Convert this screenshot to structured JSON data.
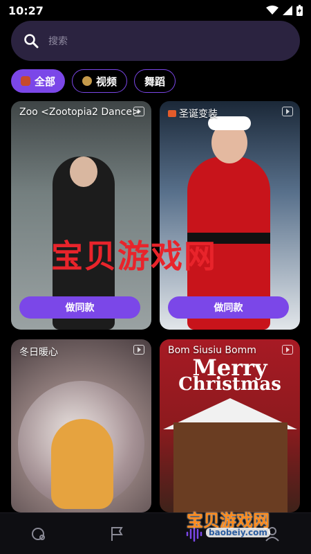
{
  "status": {
    "time": "10:27"
  },
  "search": {
    "placeholder": "搜索"
  },
  "tabs": [
    {
      "label": "全部",
      "active": true
    },
    {
      "label": "视频",
      "active": false
    },
    {
      "label": "舞蹈",
      "active": false
    }
  ],
  "cards": [
    {
      "title": "Zoo <Zootopia2 Dance>",
      "button": "做同款"
    },
    {
      "title": "圣诞变装",
      "button": "做同款"
    },
    {
      "title": "冬日暖心"
    },
    {
      "title": "Bom Siusiu Bomm",
      "art_line1": "Merry",
      "art_line2": "Christmas"
    }
  ],
  "watermark": {
    "text": "宝贝游戏网",
    "corner_text": "宝贝游戏网",
    "corner_url": "baobeiy.com"
  },
  "bottom_nav": {
    "icons": [
      "home-icon",
      "flag-icon",
      "waveform-icon",
      "profile-icon"
    ],
    "active": 2
  },
  "colors": {
    "accent": "#7b47e8",
    "background": "#000000",
    "search_bg": "#2b2340"
  }
}
